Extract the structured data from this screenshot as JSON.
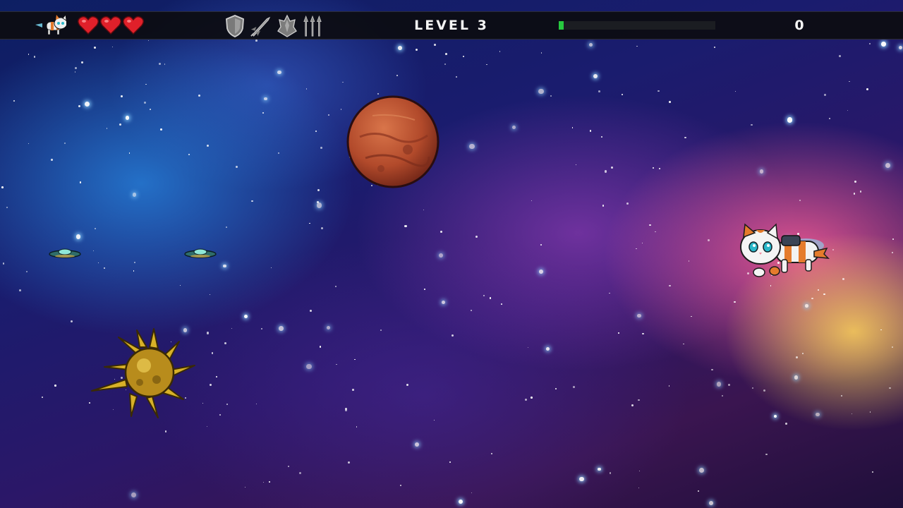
{
  "hud": {
    "level_label": "LEVEL 3",
    "score": "0",
    "lives": 3,
    "level_progress": 0.03,
    "powerups": [
      "shield-icon",
      "missile-icon",
      "armor-icon",
      "triple-arrow-icon"
    ],
    "colors": {
      "heart": "#e0202a",
      "progress": "#27c93f",
      "powerup_inactive": "#9a9a9a"
    }
  },
  "scene": {
    "player": "space-cat-jetpack",
    "planet": "red-planet",
    "enemies": [
      "alien-saucer",
      "alien-saucer",
      "spiked-space-mine"
    ]
  }
}
